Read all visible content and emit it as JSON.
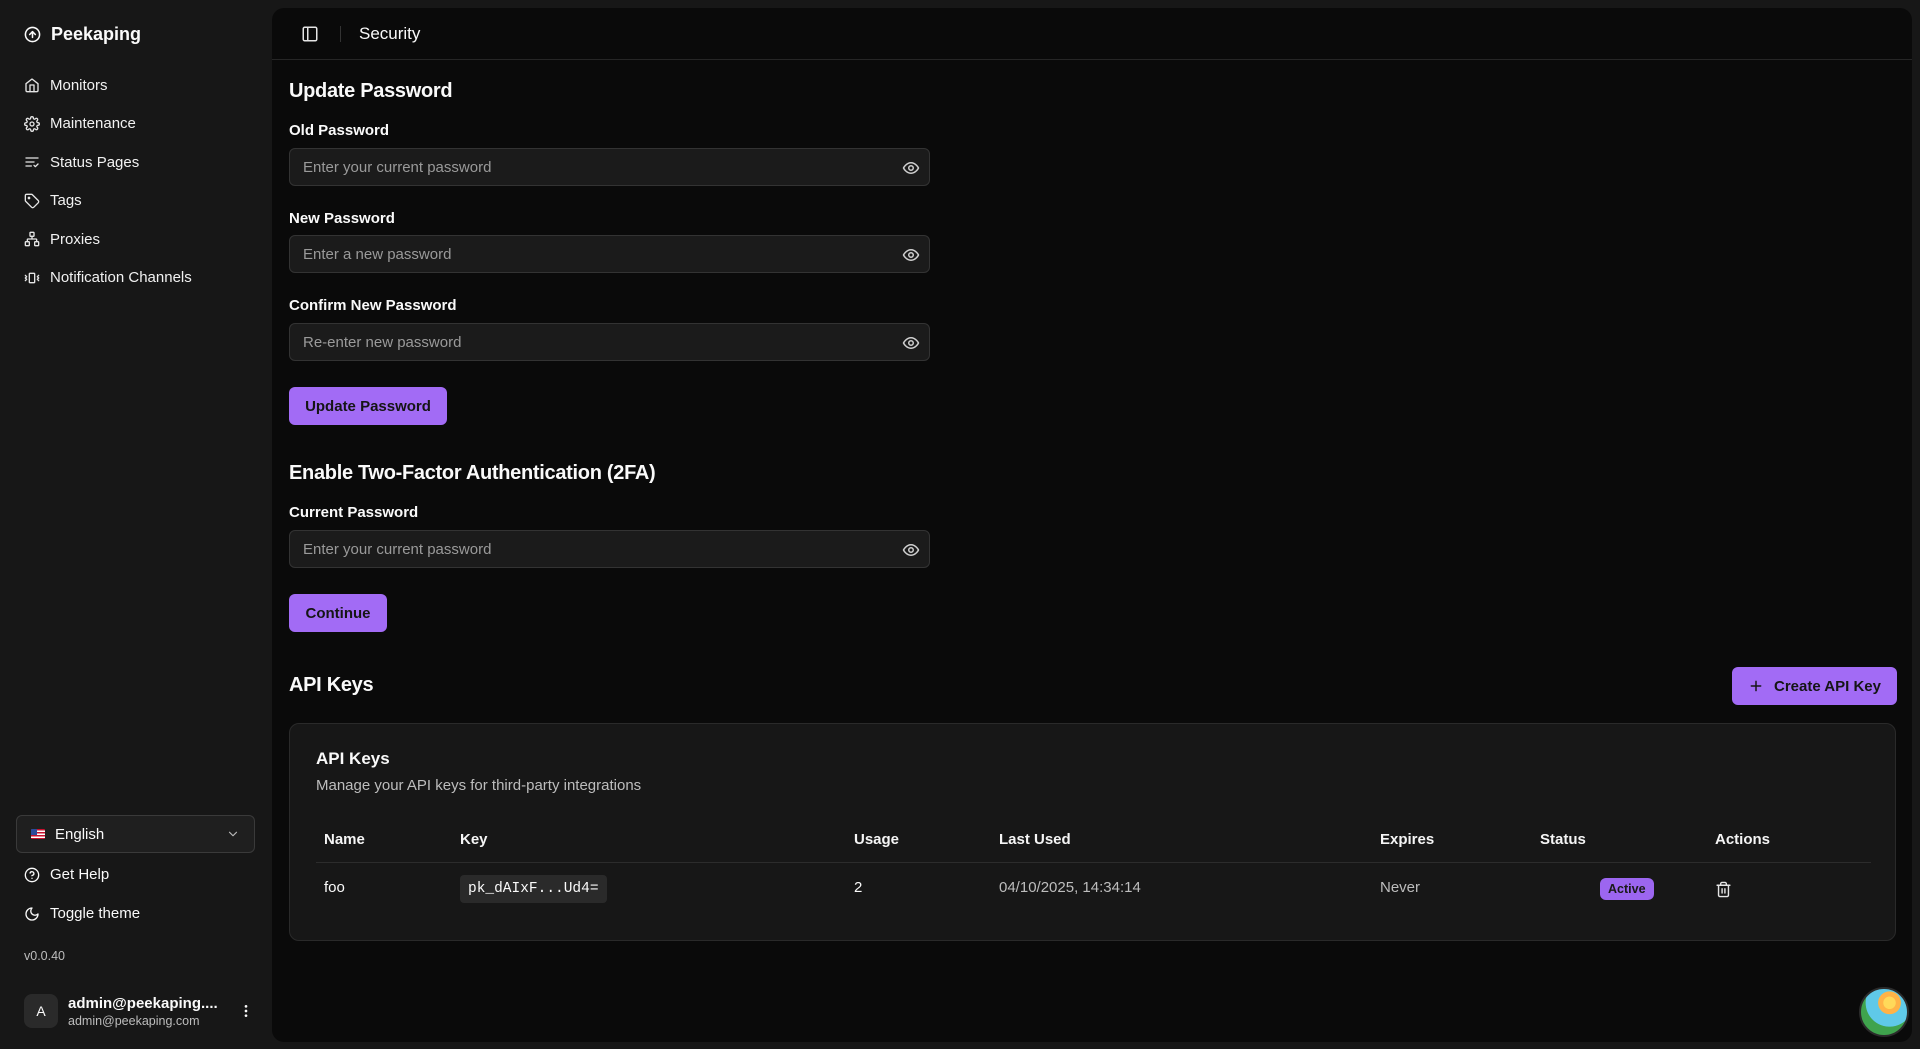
{
  "sidebar": {
    "brand": "Peekaping",
    "items": [
      {
        "label": "Monitors",
        "icon": "home-icon"
      },
      {
        "label": "Maintenance",
        "icon": "gear-icon"
      },
      {
        "label": "Status Pages",
        "icon": "list-icon"
      },
      {
        "label": "Tags",
        "icon": "tag-icon"
      },
      {
        "label": "Proxies",
        "icon": "network-icon"
      },
      {
        "label": "Notification Channels",
        "icon": "vibrate-icon"
      }
    ],
    "language": "English",
    "help_label": "Get Help",
    "theme_label": "Toggle theme",
    "version": "v0.0.40",
    "user": {
      "initial": "A",
      "name": "admin@peekaping....",
      "email": "admin@peekaping.com"
    }
  },
  "header": {
    "title": "Security"
  },
  "update_password": {
    "title": "Update Password",
    "old_label": "Old Password",
    "old_placeholder": "Enter your current password",
    "new_label": "New Password",
    "new_placeholder": "Enter a new password",
    "confirm_label": "Confirm New Password",
    "confirm_placeholder": "Re-enter new password",
    "button": "Update Password"
  },
  "two_factor": {
    "title": "Enable Two-Factor Authentication (2FA)",
    "current_label": "Current Password",
    "current_placeholder": "Enter your current password",
    "button": "Continue"
  },
  "api_keys": {
    "title": "API Keys",
    "create_button": "Create API Key",
    "card_title": "API Keys",
    "card_description": "Manage your API keys for third-party integrations",
    "columns": [
      "Name",
      "Key",
      "Usage",
      "Last Used",
      "Expires",
      "Status",
      "Actions"
    ],
    "rows": [
      {
        "name": "foo",
        "key": "pk_dAIxF...Ud4=",
        "usage": "2",
        "last_used": "04/10/2025, 14:34:14",
        "expires": "Never",
        "status": "Active"
      }
    ]
  },
  "colors": {
    "accent": "#a26bf5",
    "sidebar_bg": "#171717",
    "main_bg": "#0a0a0a"
  }
}
